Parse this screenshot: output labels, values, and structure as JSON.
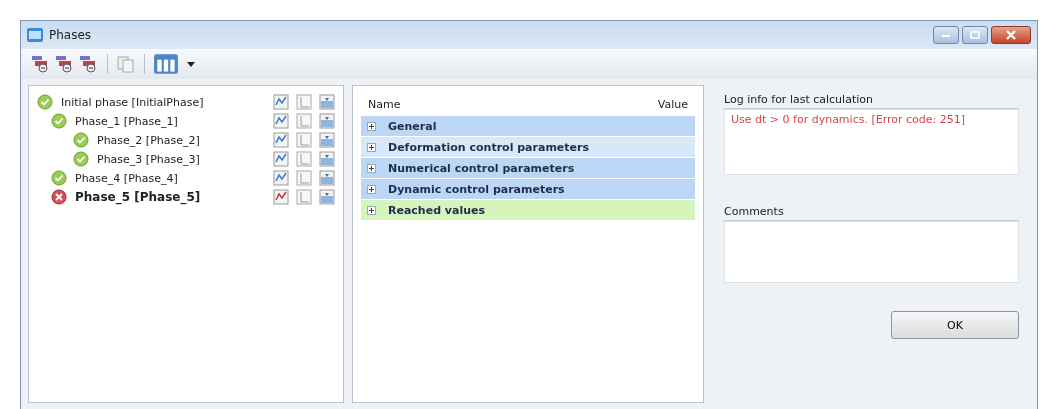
{
  "window": {
    "title": "Phases"
  },
  "phases": [
    {
      "label": "Initial phase [InitialPhase]",
      "failed": false,
      "selected": false,
      "children": [
        {
          "label": "Phase_1 [Phase_1]",
          "failed": false,
          "selected": false,
          "children": [
            {
              "label": "Phase_2 [Phase_2]",
              "failed": false,
              "selected": false
            },
            {
              "label": "Phase_3 [Phase_3]",
              "failed": false,
              "selected": false
            }
          ]
        },
        {
          "label": "Phase_4 [Phase_4]",
          "failed": false,
          "selected": false
        },
        {
          "label": "Phase_5 [Phase_5]",
          "failed": true,
          "selected": true
        }
      ]
    }
  ],
  "properties": {
    "columns": [
      "Name",
      "Value"
    ],
    "rows": [
      {
        "label": "General",
        "expanded": false,
        "color": "#bcd7f6"
      },
      {
        "label": "Deformation control parameters",
        "expanded": false,
        "color": "#d9e8f9"
      },
      {
        "label": "Numerical control parameters",
        "expanded": false,
        "color": "#bcd7f6"
      },
      {
        "label": "Dynamic control parameters",
        "expanded": false,
        "color": "#bcd7f6"
      },
      {
        "label": "Reached values",
        "expanded": false,
        "color": "#d6f5bd"
      }
    ]
  },
  "log": {
    "title": "Log info for last calculation",
    "message": "Use dt > 0 for dynamics. [Error code: 251]"
  },
  "comments": {
    "title": "Comments"
  },
  "buttons": [
    "OK"
  ]
}
